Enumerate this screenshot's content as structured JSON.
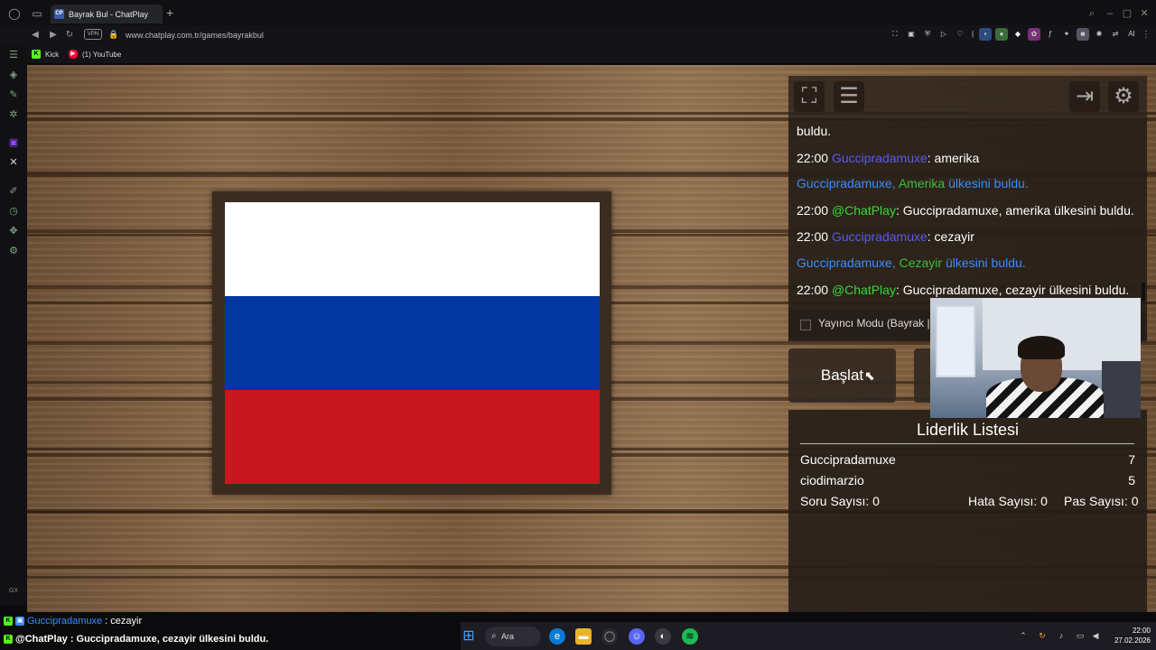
{
  "browser": {
    "tab_title": "Bayrak Bul - ChatPlay",
    "tab_favicon": "CP",
    "new_tab": "+",
    "vpn": "VPN",
    "url": "www.chatplay.com.tr/games/bayrakbul",
    "ai_label": "AI",
    "bookmarks": [
      {
        "label": "Kick",
        "icon": "K",
        "color": "#53fc18"
      },
      {
        "label": "(1) YouTube",
        "icon": "▶",
        "color": "#ff0033"
      }
    ]
  },
  "game": {
    "flag": {
      "country": "Russia",
      "colors": [
        "#ffffff",
        "#0037a0",
        "#c8161f"
      ]
    },
    "chat": [
      {
        "time": "",
        "user": "",
        "text": "buldu."
      },
      {
        "time": "22:00",
        "user": "Guccipradamuxe",
        "text": ": amerika"
      },
      {
        "found_user": "Guccipradamuxe,",
        "country": "Amerika",
        "suffix": "ülkesini buldu."
      },
      {
        "time": "22:00",
        "bot": "@ChatPlay",
        "text": ": Guccipradamuxe, amerika ülkesini buldu."
      },
      {
        "time": "22:00",
        "user": "Guccipradamuxe",
        "text": ": cezayir"
      },
      {
        "found_user": "Guccipradamuxe,",
        "country": "Cezayir",
        "suffix": "ülkesini buldu."
      },
      {
        "time": "22:00",
        "bot": "@ChatPlay",
        "text": ": Guccipradamuxe, cezayir ülkesini buldu."
      }
    ],
    "streamer_mode_label": "Yayıncı Modu (Bayrak |",
    "start_label": "Başlat",
    "leaderboard": {
      "title": "Liderlik Listesi",
      "rows": [
        {
          "name": "Guccipradamuxe",
          "score": "7"
        },
        {
          "name": "ciodimarzio",
          "score": "5"
        }
      ],
      "question_count": "Soru Sayısı: 0",
      "error_count": "Hata Sayısı: 0",
      "pass_count": "Pas Sayısı: 0"
    }
  },
  "overlay_chat": [
    {
      "user": "Guccipradamuxe",
      "text": ": cezayir"
    },
    {
      "user": "@ChatPlay",
      "text": " : Guccipradamuxe, cezayir ülkesini buldu."
    }
  ],
  "taskbar": {
    "search_label": "Ara",
    "time": "22:00",
    "date": "27.02.2026"
  },
  "sidebar_label": "GX"
}
